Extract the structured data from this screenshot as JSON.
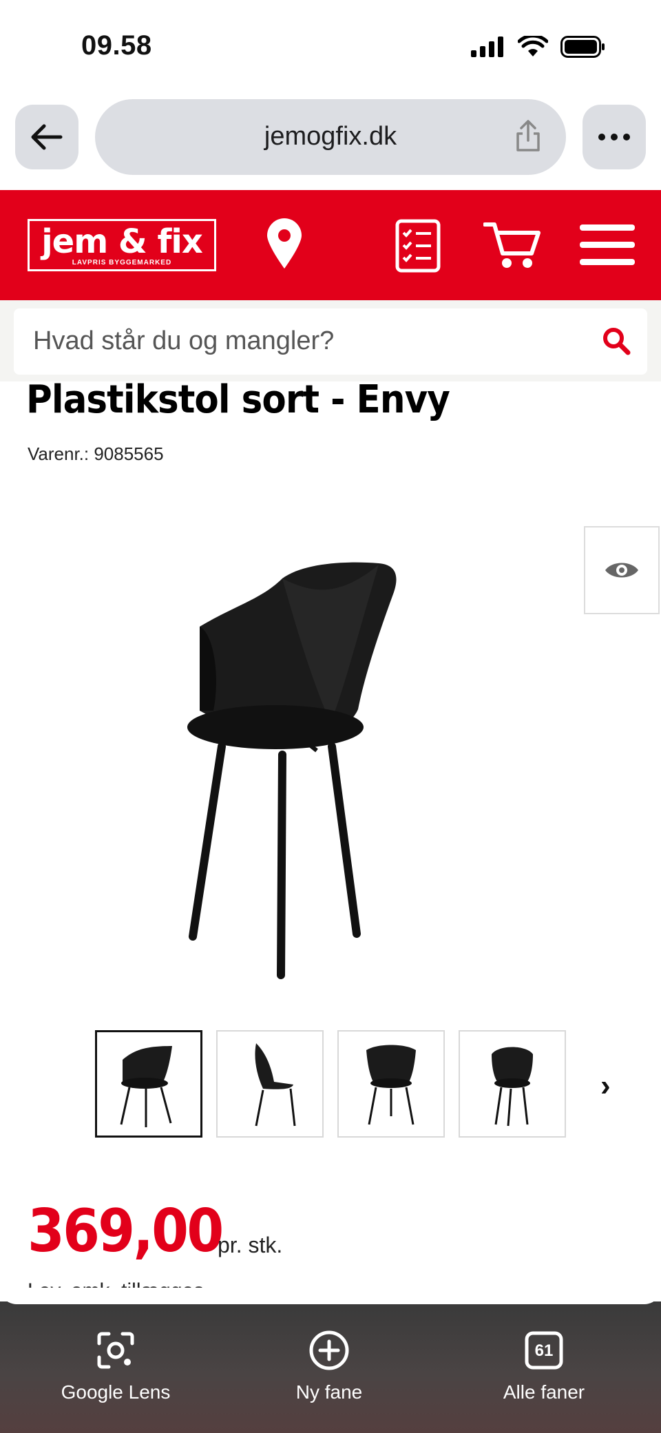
{
  "status_bar": {
    "time": "09.58"
  },
  "browser": {
    "url": "jemogfix.dk"
  },
  "site": {
    "logo_text": "jem & fix",
    "logo_tagline": "LAVPRIS BYGGEMARKED",
    "search_placeholder": "Hvad står du og mangler?"
  },
  "product": {
    "title": "Plastikstol sort - Envy",
    "sku": "Varenr.: 9085565",
    "price": "369,00",
    "price_unit": "pr. stk.",
    "delivery_note": "Lev. omk. tillægges",
    "thumbnails_count": 4,
    "active_thumbnail": 1
  },
  "bottom_toolbar": {
    "items": [
      {
        "label": "Google Lens",
        "icon": "camera-lens-icon"
      },
      {
        "label": "Ny fane",
        "icon": "plus-circle-icon"
      },
      {
        "label": "Alle faner",
        "icon": "tabs-icon",
        "badge": "61"
      }
    ]
  },
  "colors": {
    "brand_red": "#e2001a",
    "chrome_grey": "#dcdee3"
  }
}
